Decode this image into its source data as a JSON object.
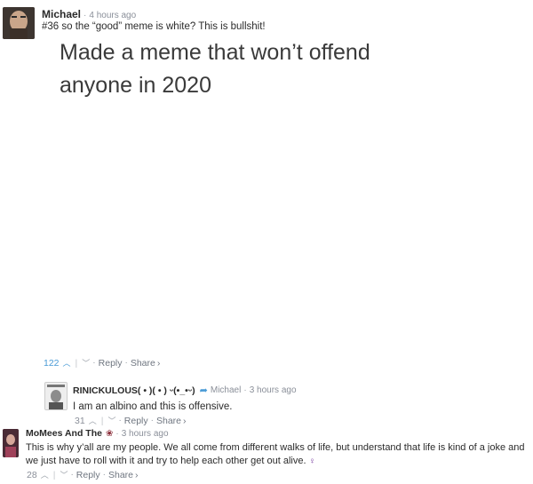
{
  "comment1": {
    "author": "Michael",
    "time": "4 hours ago",
    "text": "#36 so the “good” meme is white? This is bullshit!",
    "meme_line1": "Made a meme that won’t offend",
    "meme_line2": "anyone in 2020",
    "upvotes": "122",
    "reply": "Reply",
    "share": "Share"
  },
  "comment2": {
    "author": "RINICKULOUS( • )( • ) ᵕ(•_•ᵕ)",
    "reply_to": "Michael",
    "time": "3 hours ago",
    "text": "I am an albino and this is offensive.",
    "upvotes": "31",
    "reply": "Reply",
    "share": "Share"
  },
  "comment3": {
    "author": "MoMees And The",
    "time": "3 hours ago",
    "text": "This is why y’all are my people. We all come from different walks of life, but understand that life is kind of a joke and we just have to roll with it and try to help each other get out alive.",
    "upvotes": "28",
    "reply": "Reply",
    "share": "Share"
  },
  "colors": {
    "upvote": "#4a9bd6",
    "muted": "#8a8f99",
    "text": "#2a2a2a"
  }
}
